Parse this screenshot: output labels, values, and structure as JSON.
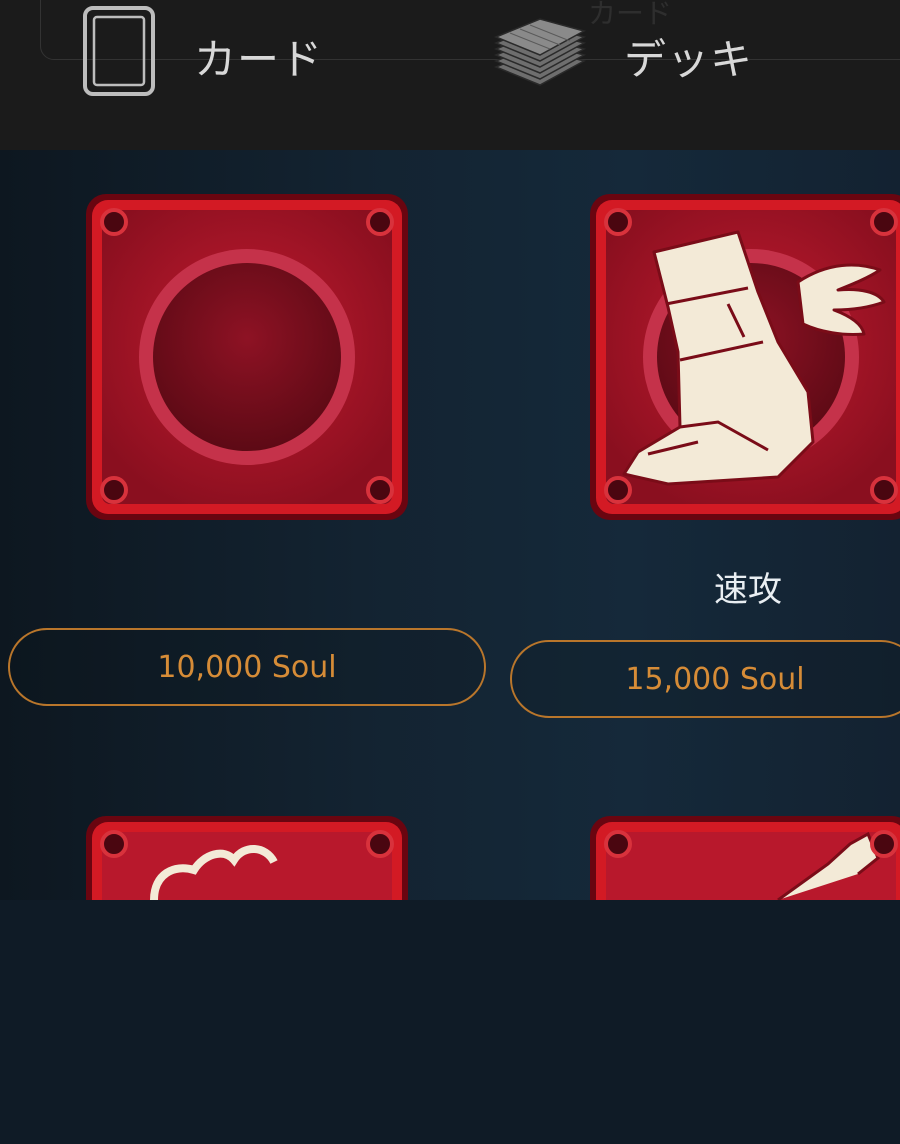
{
  "header": {
    "ghost_label": "カード",
    "tabs": [
      {
        "label": "カード",
        "icon": "card-outline-icon"
      },
      {
        "label": "デッキ",
        "icon": "card-deck-icon"
      }
    ]
  },
  "colors": {
    "tile_red": "#c3182b",
    "price_accent": "#d68c37",
    "background": "#0f1b26"
  },
  "items": [
    {
      "name": "",
      "price": "10,000 Soul",
      "icon": "empty-circle-icon"
    },
    {
      "name": "速攻",
      "price": "15,000 Soul",
      "icon": "winged-boot-icon"
    },
    {
      "name": "",
      "price": "",
      "icon": "partial-tile-icon"
    },
    {
      "name": "",
      "price": "",
      "icon": "partial-tile-icon"
    }
  ]
}
